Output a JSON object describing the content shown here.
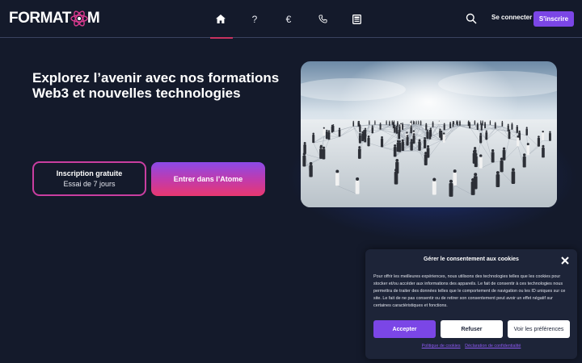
{
  "header": {
    "logo_text_left": "FORMAT",
    "logo_text_right": "M",
    "nav": [
      {
        "icon": "home-icon",
        "label": ""
      },
      {
        "icon": "question-icon",
        "label": "?"
      },
      {
        "icon": "euro-icon",
        "label": "€"
      },
      {
        "icon": "phone-icon",
        "label": ""
      },
      {
        "icon": "newspaper-icon",
        "label": ""
      }
    ],
    "login_label": "Se connecter",
    "signup_label": "S'inscrire"
  },
  "hero": {
    "title": "Explorez l’avenir avec nos formations Web3 et nouvelles technologies",
    "btn_primary_line1": "Inscription gratuite",
    "btn_primary_line2": "Essai de 7 jours",
    "btn_secondary": "Entrer dans l’Atome"
  },
  "cookie": {
    "title": "Gérer le consentement aux cookies",
    "text": "Pour offrir les meilleures expériences, nous utilisons des technologies telles que les cookies pour stocker et/ou accéder aux informations des appareils. Le fait de consentir à ces technologies nous permettra de traiter des données telles que le comportement de navigation ou les ID uniques sur ce site. Le fait de ne pas consentir ou de retirer son consentement peut avoir un effet négatif sur certaines caractéristiques et fonctions.",
    "accept_label": "Accepter",
    "refuse_label": "Refuser",
    "prefs_label": "Voir les préférences",
    "link_policy": "Politique de cookies",
    "link_privacy": "Déclaration de confidentialité"
  },
  "colors": {
    "background": "#141a2b",
    "accent_purple": "#7b46e6",
    "accent_pink": "#e8386f",
    "active_underline": "#c8325f"
  }
}
